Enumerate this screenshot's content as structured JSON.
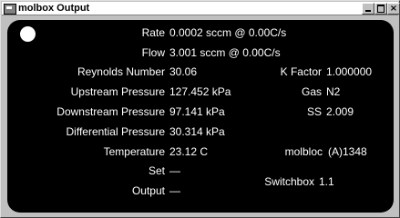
{
  "window": {
    "title": "molbox Output",
    "buttons": {
      "minimize": "_",
      "maximize": "□",
      "close": "×"
    }
  },
  "readouts": {
    "rate": {
      "label": "Rate",
      "value": "0.0002 sccm @ 0.00C/s"
    },
    "flow": {
      "label": "Flow",
      "value": "3.001  sccm @ 0.00C/s"
    },
    "reynolds": {
      "label": "Reynolds Number",
      "value": "30.06"
    },
    "upstream": {
      "label": "Upstream Pressure",
      "value": "127.452 kPa"
    },
    "downstream": {
      "label": "Downstream Pressure",
      "value": "97.141 kPa"
    },
    "differential": {
      "label": "Differential Pressure",
      "value": "30.314 kPa"
    },
    "temperature": {
      "label": "Temperature",
      "value": "23.12 C"
    },
    "set": {
      "label": "Set",
      "value": "—"
    },
    "output": {
      "label": "Output",
      "value": "—"
    }
  },
  "info": {
    "kfactor": {
      "label": "K Factor",
      "value": "1.000000"
    },
    "gas": {
      "label": "Gas",
      "value": "N2"
    },
    "ss": {
      "label": "SS",
      "value": "2.009"
    },
    "molbloc": {
      "label": "molbloc",
      "value": "(A)1348"
    },
    "switchbox": {
      "label": "Switchbox",
      "value": "1.1"
    }
  },
  "colors": {
    "panel": "#000000",
    "text": "#ffffff",
    "chrome": "#c0c0c0"
  }
}
